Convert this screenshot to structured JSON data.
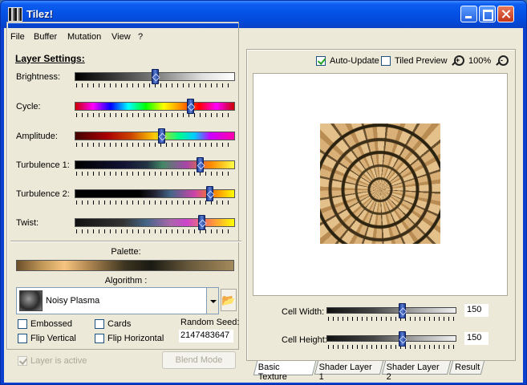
{
  "window": {
    "title": "Tilez!"
  },
  "menu": [
    "File",
    "Buffer",
    "Mutation",
    "View",
    "?"
  ],
  "layer_settings": {
    "title": "Layer Settings:",
    "sliders": [
      {
        "label": "Brightness:",
        "value": 0.5
      },
      {
        "label": "Cycle:",
        "value": 0.72
      },
      {
        "label": "Amplitude:",
        "value": 0.54
      },
      {
        "label": "Turbulence 1:",
        "value": 0.78
      },
      {
        "label": "Turbulence 2:",
        "value": 0.84
      },
      {
        "label": "Twist:",
        "value": 0.79
      }
    ],
    "palette_label": "Palette:",
    "algorithm_label": "Algorithm :",
    "algorithm": "Noisy Plasma",
    "options": {
      "embossed": "Embossed",
      "cards": "Cards",
      "flip_vertical": "Flip Vertical",
      "flip_horizontal": "Flip Horizontal"
    },
    "random_seed_label": "Random Seed:",
    "random_seed": "2147483647",
    "layer_active": "Layer is active",
    "blend_mode": "Blend Mode"
  },
  "preview": {
    "auto_update": "Auto-Update",
    "tiled_preview": "Tiled Preview",
    "zoom": "100%",
    "cell_width_label": "Cell Width:",
    "cell_width": "150",
    "cell_width_fraction": 0.58,
    "cell_height_label": "Cell Height:",
    "cell_height": "150",
    "cell_height_fraction": 0.58
  },
  "tabs": [
    "Basic Texture",
    "Shader Layer 1",
    "Shader Layer 2",
    "Result"
  ],
  "colors": {
    "titlebar": "#0551e6",
    "texture_base": "#cfa46c",
    "face": "#ece9d8"
  }
}
